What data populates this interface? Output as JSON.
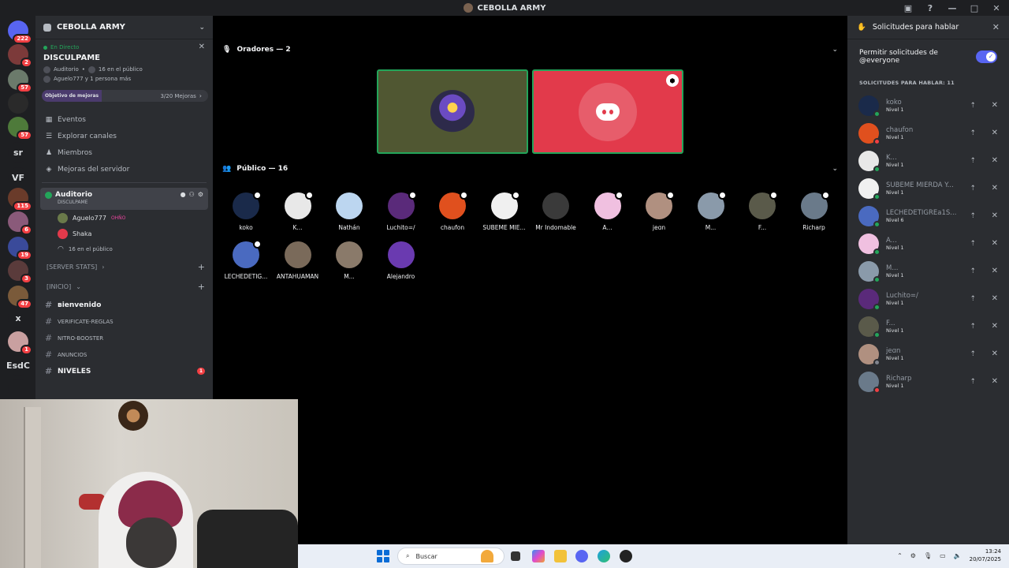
{
  "window": {
    "title": "CEBOLLA ARMY"
  },
  "guilds": [
    {
      "label": "",
      "badge": "222",
      "color": "#5865f2"
    },
    {
      "label": "",
      "badge": "2",
      "color": "#7c3a3a"
    },
    {
      "label": "",
      "badge": "57",
      "color": "#6b7a6b"
    },
    {
      "label": "",
      "badge": "",
      "color": "#2a2a2a"
    },
    {
      "label": "",
      "badge": "57",
      "color": "#4e7a3a"
    },
    {
      "label": "sr",
      "badge": "",
      "color": "#1e1f22"
    },
    {
      "label": "VF",
      "badge": "",
      "color": "#1e1f22"
    },
    {
      "label": "",
      "badge": "115",
      "color": "#6a3b2a"
    },
    {
      "label": "",
      "badge": "6",
      "color": "#8a5a7a"
    },
    {
      "label": "",
      "badge": "19",
      "color": "#3a4a9a"
    },
    {
      "label": "",
      "badge": "3",
      "color": "#5a3b3b"
    },
    {
      "label": "",
      "badge": "47",
      "color": "#7a5a3a"
    },
    {
      "label": "x",
      "badge": "",
      "color": "#1e1f22"
    },
    {
      "label": "",
      "badge": "1",
      "color": "#c9a0a0"
    },
    {
      "label": "EsdC",
      "badge": "",
      "color": "#1e1f22"
    },
    {
      "label": "",
      "badge": "",
      "color": "#1e1f22"
    }
  ],
  "server": {
    "name": "CEBOLLA ARMY"
  },
  "live": {
    "label": "En Directo",
    "title": "DISCULPAME",
    "channel": "Auditorio",
    "audience": "16 en el público",
    "speakers": "Aguelo777 y 1 persona más"
  },
  "boost": {
    "label": "Objetivo de mejoras",
    "count": "3/20 Mejoras"
  },
  "menu": [
    {
      "label": "Eventos",
      "icon": "calendar-icon"
    },
    {
      "label": "Explorar canales",
      "icon": "channels-icon"
    },
    {
      "label": "Miembros",
      "icon": "members-icon"
    },
    {
      "label": "Mejoras del servidor",
      "icon": "boost-icon"
    }
  ],
  "stage_channel": {
    "name": "Auditorio",
    "topic": "DISCULPAME",
    "users": [
      {
        "name": "Aguelo777",
        "tag": "OHÑO"
      },
      {
        "name": "Shaka",
        "tag": ""
      }
    ],
    "audience": "16 en el público"
  },
  "categories": {
    "server_stats": "SERVER STATS",
    "inicio": "INICIO"
  },
  "channels": [
    {
      "name": "віenvenіdo",
      "bold": true,
      "badge": ""
    },
    {
      "name": "VERIFICATE-REGLAS",
      "bold": false,
      "badge": ""
    },
    {
      "name": "NITRO-BOOSTER",
      "bold": false,
      "badge": ""
    },
    {
      "name": "ANUNCIOS",
      "bold": false,
      "badge": ""
    },
    {
      "name": "NIVELES",
      "bold": true,
      "badge": "1"
    }
  ],
  "stage": {
    "speakers_header": "Oradores — 2",
    "audience_header": "Público — 16",
    "audience": [
      {
        "name": "koko",
        "color": "#1a2a4a",
        "badge": true
      },
      {
        "name": "K...",
        "color": "#e8e8e8",
        "badge": true
      },
      {
        "name": "Nathán",
        "color": "#bcd6f0",
        "badge": false
      },
      {
        "name": "Luchito=/",
        "color": "#5a2a7a",
        "badge": true
      },
      {
        "name": "chaufon",
        "color": "#e0501e",
        "badge": true
      },
      {
        "name": "SUBEME MIE...",
        "color": "#f0f0f0",
        "badge": true
      },
      {
        "name": "Mr Indomable",
        "color": "#3a3a3a",
        "badge": false
      },
      {
        "name": "A...",
        "color": "#f0c0e0",
        "badge": true
      },
      {
        "name": "jeɑn",
        "color": "#b09080",
        "badge": true
      },
      {
        "name": "M...",
        "color": "#8a9aaa",
        "badge": true
      },
      {
        "name": "F...",
        "color": "#5a5a4a",
        "badge": true
      },
      {
        "name": "Richarp",
        "color": "#6a7a8a",
        "badge": true
      },
      {
        "name": "LECHEDETIG...",
        "color": "#4a6ac0",
        "badge": true
      },
      {
        "name": "ANTAHUAMAN",
        "color": "#7a6a5a",
        "badge": false
      },
      {
        "name": "M...",
        "color": "#8a7a6a",
        "badge": false
      },
      {
        "name": "Alejandro",
        "color": "#6a3ab0",
        "badge": false
      }
    ]
  },
  "requests_panel": {
    "title": "Solicitudes para hablar",
    "toggle_label": "Permitir solicitudes de @everyone",
    "count_label": "SOLICITUDES PARA HABLAR: 11",
    "requests": [
      {
        "name": "koko",
        "level": "Nivel 1",
        "color": "#1a2a4a",
        "status": "#23a55a"
      },
      {
        "name": "chaufon",
        "level": "Nivel 1",
        "color": "#e0501e",
        "status": "#f23f43"
      },
      {
        "name": "K...",
        "level": "Nivel 1",
        "color": "#e8e8e8",
        "status": "#23a55a"
      },
      {
        "name": "SUBEME MIERDA Y...",
        "level": "Nivel 1",
        "color": "#f0f0f0",
        "status": "#23a55a"
      },
      {
        "name": "LECHEDETIGREa1S...",
        "level": "Nivel 6",
        "color": "#4a6ac0",
        "status": "#23a55a"
      },
      {
        "name": "A...",
        "level": "Nivel 1",
        "color": "#f0c0e0",
        "status": "#23a55a"
      },
      {
        "name": "M...",
        "level": "Nivel 1",
        "color": "#8a9aaa",
        "status": "#23a55a"
      },
      {
        "name": "Luchito=/",
        "level": "Nivel 1",
        "color": "#5a2a7a",
        "status": "#23a55a"
      },
      {
        "name": "F...",
        "level": "Nivel 1",
        "color": "#5a5a4a",
        "status": "#23a55a"
      },
      {
        "name": "jeɑn",
        "level": "Nivel 1",
        "color": "#b09080",
        "status": "#80848e"
      },
      {
        "name": "Richarp",
        "level": "Nivel 1",
        "color": "#6a7a8a",
        "status": "#f23f43"
      }
    ]
  },
  "taskbar": {
    "search_placeholder": "Buscar",
    "time": "13:24",
    "date": "20/07/2025"
  },
  "colors": {
    "accent": "#5865f2",
    "green": "#23a55a",
    "red": "#f23f43",
    "speaker_tile_2": "#e23a4b",
    "speaker_tile_1": "#505732"
  }
}
